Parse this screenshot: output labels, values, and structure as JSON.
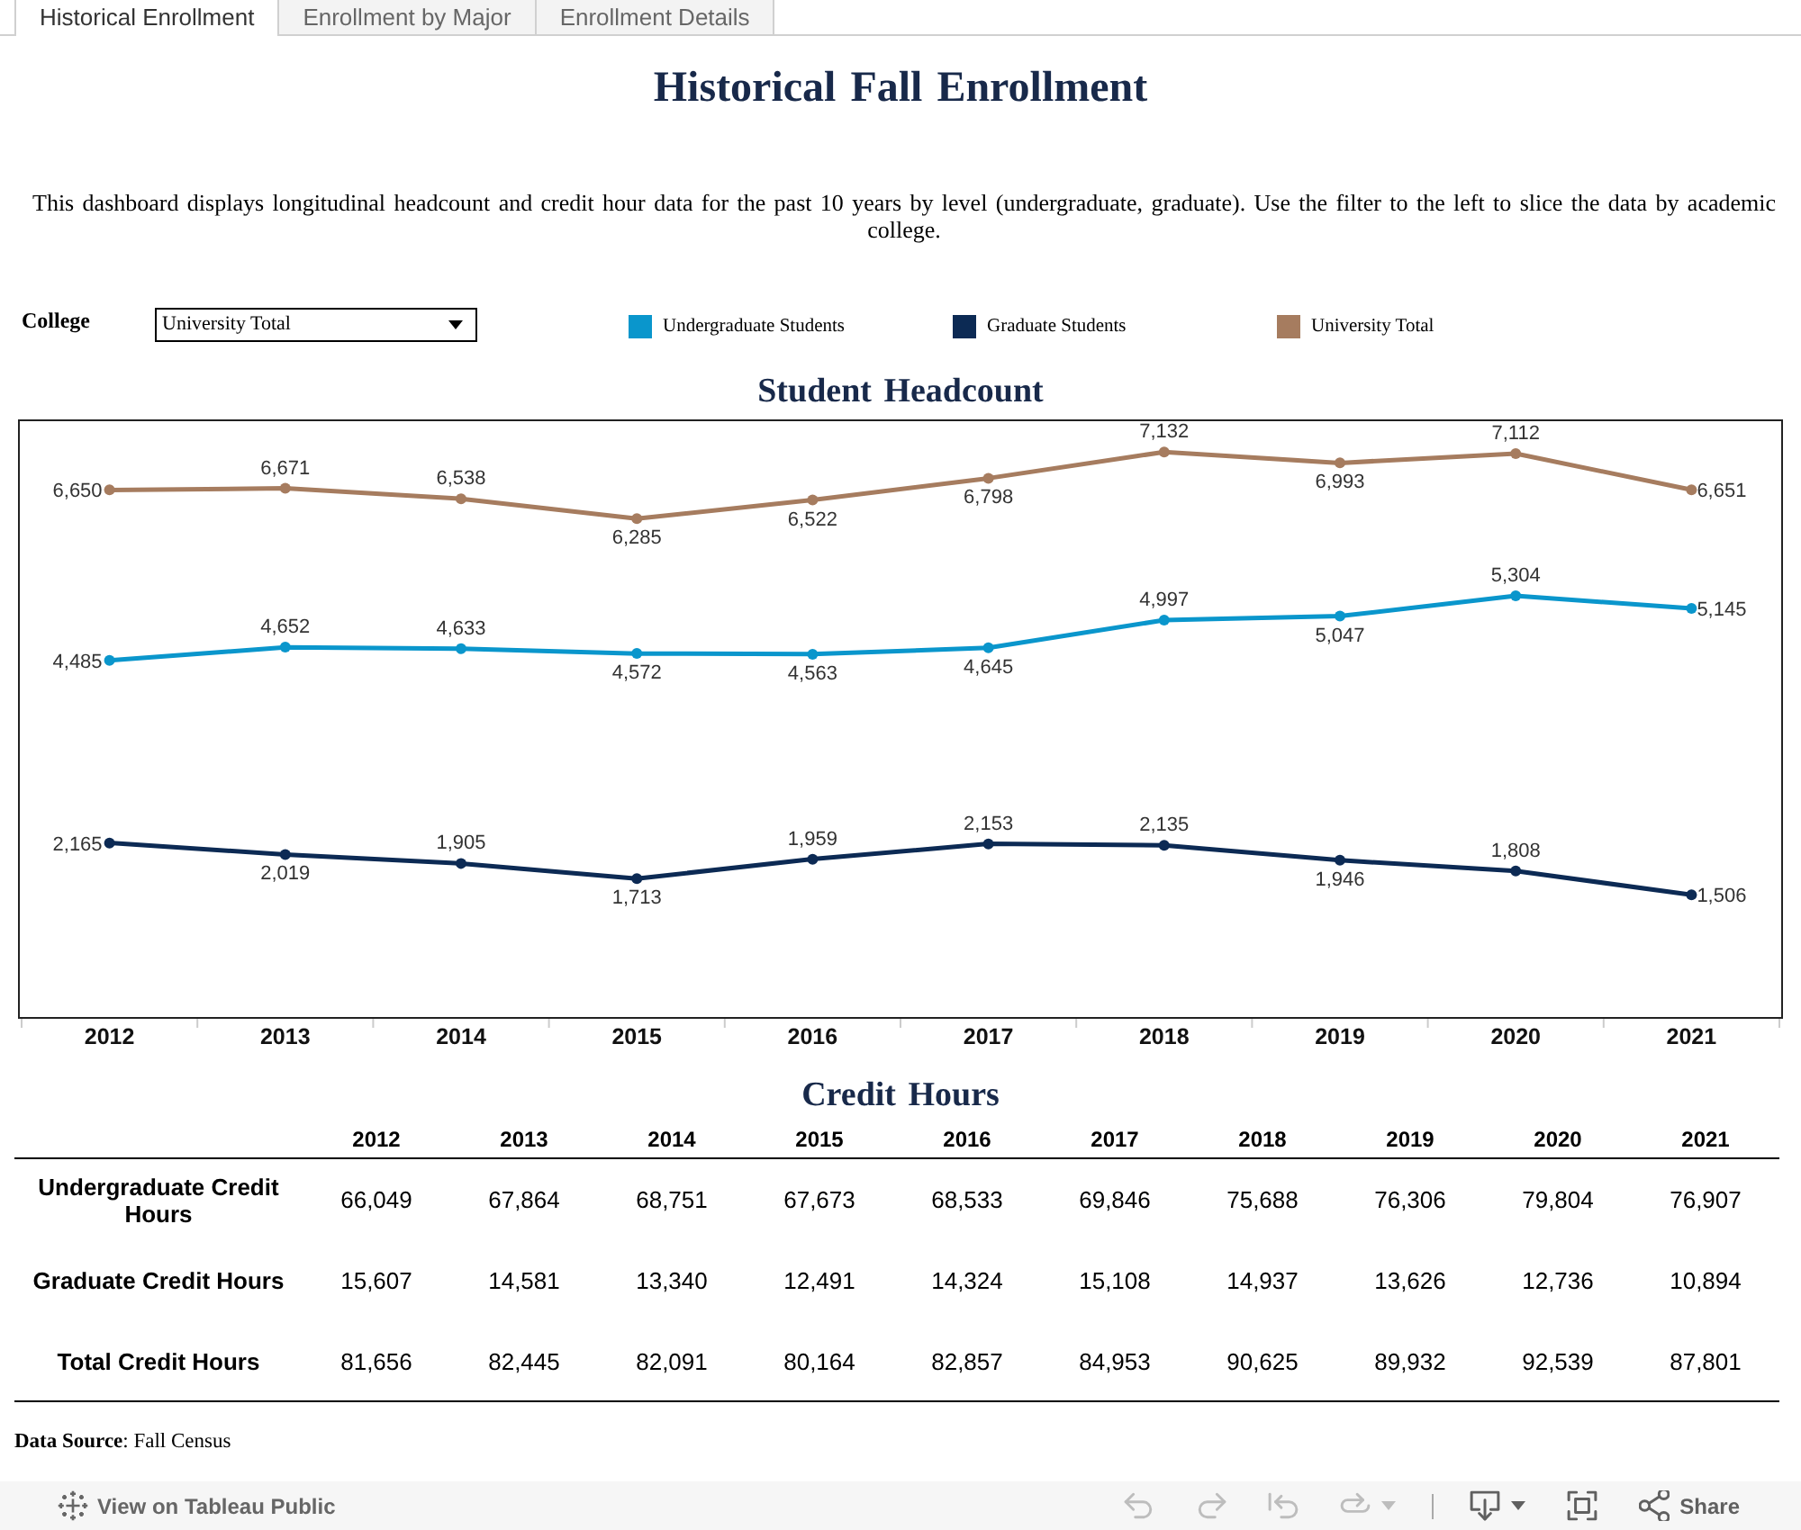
{
  "tabs": [
    {
      "label": "Historical Enrollment",
      "selected": true
    },
    {
      "label": "Enrollment by Major",
      "selected": false
    },
    {
      "label": "Enrollment Details",
      "selected": false
    }
  ],
  "title": "Historical Fall Enrollment",
  "description": "This dashboard displays longitudinal headcount and credit hour data for the past 10 years by level (undergraduate, graduate). Use the filter to the left to slice the data by academic college.",
  "filter": {
    "label": "College",
    "value": "University Total"
  },
  "headcount": {
    "chart_data": {
      "type": "line",
      "title": "Student Headcount",
      "legend": "top",
      "categories": [
        "2012",
        "2013",
        "2014",
        "2015",
        "2016",
        "2017",
        "2018",
        "2019",
        "2020",
        "2021"
      ],
      "series": [
        {
          "name": "Undergraduate Students",
          "color": "#0a96cc",
          "marker": "circle",
          "values": [
            4485,
            4652,
            4633,
            4572,
            4563,
            4645,
            4997,
            5047,
            5304,
            5145
          ],
          "value_labels": [
            "4,485",
            "4,652",
            "4,633",
            "4,572",
            "4,563",
            "4,645",
            "4,997",
            "5,047",
            "5,304",
            "5,145"
          ]
        },
        {
          "name": "Graduate Students",
          "color": "#0c2a54",
          "marker": "circle",
          "values": [
            2165,
            2019,
            1905,
            1713,
            1959,
            2153,
            2135,
            1946,
            1808,
            1506
          ],
          "value_labels": [
            "2,165",
            "2,019",
            "1,905",
            "1,713",
            "1,959",
            "2,153",
            "2,135",
            "1,946",
            "1,808",
            "1,506"
          ]
        },
        {
          "name": "University Total",
          "color": "#a67c5f",
          "marker": "circle",
          "values": [
            6650,
            6671,
            6538,
            6285,
            6522,
            6798,
            7132,
            6993,
            7112,
            6651
          ],
          "value_labels": [
            "6,650",
            "6,671",
            "6,538",
            "6,285",
            "6,522",
            "6,798",
            "7,132",
            "6,993",
            "7,112",
            "6,651"
          ]
        }
      ]
    }
  },
  "credit_hours": {
    "title": "Credit Hours",
    "columns": [
      "2012",
      "2013",
      "2014",
      "2015",
      "2016",
      "2017",
      "2018",
      "2019",
      "2020",
      "2021"
    ],
    "rows": [
      {
        "label": "Undergraduate Credit Hours",
        "values": [
          "66,049",
          "67,864",
          "68,751",
          "67,673",
          "68,533",
          "69,846",
          "75,688",
          "76,306",
          "79,804",
          "76,907"
        ]
      },
      {
        "label": "Graduate Credit Hours",
        "values": [
          "15,607",
          "14,581",
          "13,340",
          "12,491",
          "14,324",
          "15,108",
          "14,937",
          "13,626",
          "12,736",
          "10,894"
        ]
      },
      {
        "label": "Total Credit Hours",
        "values": [
          "81,656",
          "82,445",
          "82,091",
          "80,164",
          "82,857",
          "84,953",
          "90,625",
          "89,932",
          "92,539",
          "87,801"
        ]
      }
    ]
  },
  "source": "**Data Source**: Fall Census",
  "toolbar": {
    "link": "View on Tableau Public",
    "history_controls": [
      {
        "kind": "undo",
        "disabled": true
      },
      {
        "kind": "redo",
        "disabled": true
      },
      {
        "kind": "revert",
        "disabled": true
      },
      {
        "kind": "refresh",
        "disabled": true
      }
    ],
    "view_controls": [
      {
        "kind": "download",
        "disabled": false
      },
      {
        "kind": "fullscreen",
        "disabled": false
      },
      {
        "kind": "share",
        "label": "Share",
        "disabled": false
      }
    ]
  }
}
